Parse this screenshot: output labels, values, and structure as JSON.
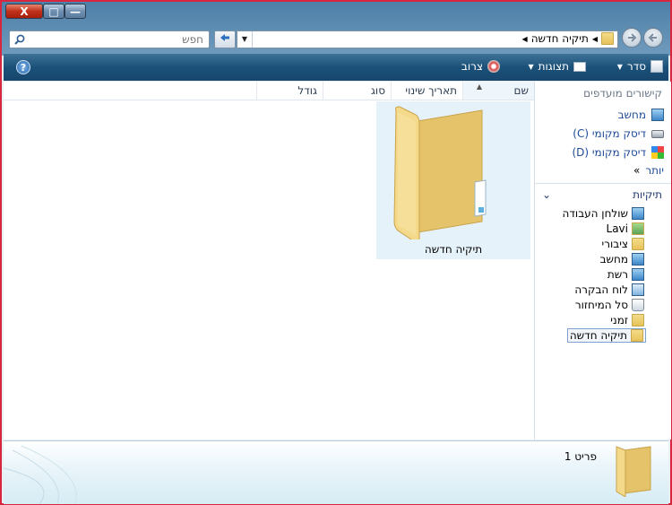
{
  "window": {
    "close_glyph": "X",
    "max_glyph": "□",
    "min_glyph": "—"
  },
  "address": {
    "search_placeholder": "חפש",
    "path": [
      "תיקיה חדשה"
    ]
  },
  "toolbar": {
    "organize": "סדר",
    "views": "תצוגות",
    "burn": "צרוב",
    "help": "?"
  },
  "nav": {
    "favorites_title": "קישורים מועדפים",
    "favorites": [
      {
        "label": "מחשב",
        "icon": "computer-icon"
      },
      {
        "label": "דיסק מקומי (C)",
        "icon": "drive-icon"
      },
      {
        "label": "דיסק מקומי (D)",
        "icon": "drive-windows-icon"
      }
    ],
    "more": "יותר",
    "more_glyph": "»",
    "folders_title": "תיקיות",
    "tree": [
      {
        "label": "שולחן העבודה",
        "icon": "desktop-icon"
      },
      {
        "label": "Lavi",
        "icon": "user-folder-icon"
      },
      {
        "label": "ציבורי",
        "icon": "folder-icon"
      },
      {
        "label": "מחשב",
        "icon": "computer-icon"
      },
      {
        "label": "רשת",
        "icon": "network-icon"
      },
      {
        "label": "לוח הבקרה",
        "icon": "control-panel-icon"
      },
      {
        "label": "סל המיחזור",
        "icon": "recycle-bin-icon"
      },
      {
        "label": "זמני",
        "icon": "folder-icon"
      },
      {
        "label": "תיקיה חדשה",
        "icon": "folder-icon",
        "selected": true
      }
    ]
  },
  "columns": {
    "name": "שם",
    "date": "תאריך שינוי",
    "type": "סוג",
    "size": "גודל"
  },
  "items": [
    {
      "label": "תיקיה חדשה",
      "icon": "folder-icon"
    }
  ],
  "details": {
    "count": "פריט 1"
  }
}
